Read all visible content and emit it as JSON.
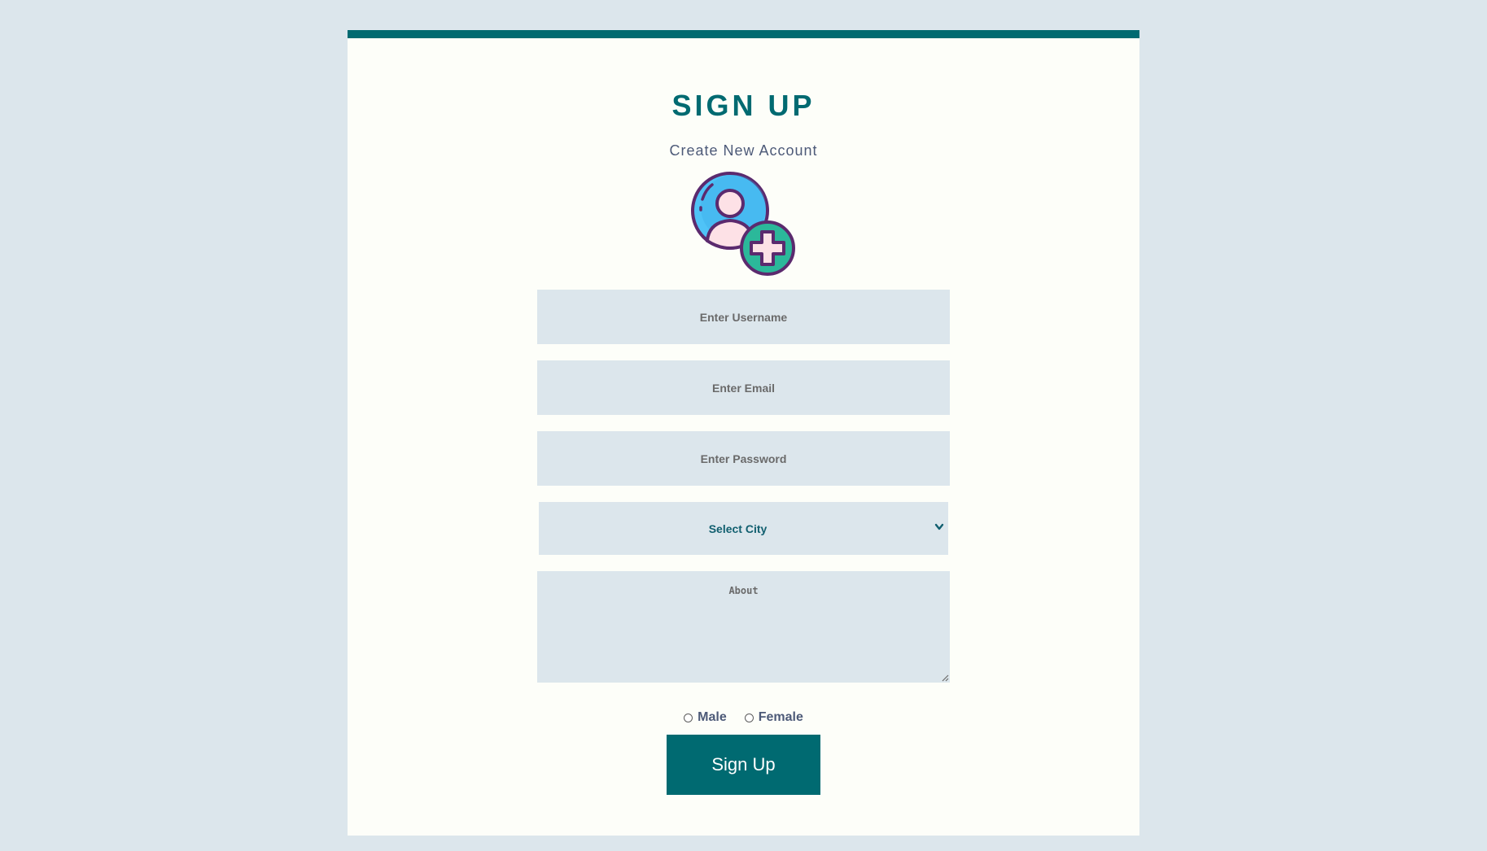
{
  "header": {
    "title": "SIGN UP",
    "subtitle": "Create New Account",
    "avatar_icon": "add-user-icon"
  },
  "form": {
    "username_placeholder": "Enter Username",
    "email_placeholder": "Enter Email",
    "password_placeholder": "Enter Password",
    "city_select": {
      "selected": "Select City"
    },
    "about_placeholder": "About",
    "gender_options": [
      "Male",
      "Female"
    ],
    "submit_label": "Sign Up"
  },
  "colors": {
    "accent": "#006a71",
    "page_bg": "#dce6ec",
    "card_bg": "#fdfef9",
    "field_bg": "#dce6ec",
    "text_muted": "#4d5a78"
  }
}
